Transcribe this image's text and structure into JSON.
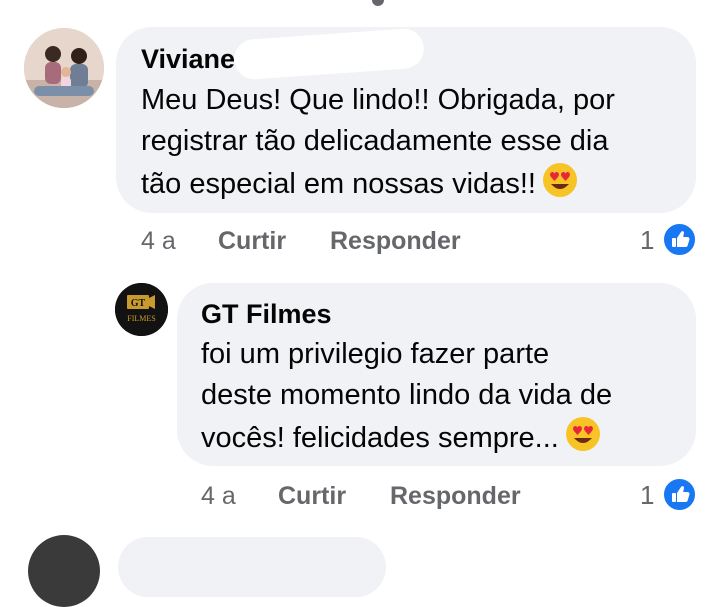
{
  "comments": [
    {
      "author": "Viviane",
      "text": "Meu Deus! Que lindo!! Obrigada, por\nregistrar tão  delicadamente esse dia\ntão  especial em nossas vidas!!",
      "emoji": "heart-eyes-emoji",
      "age": "4 a",
      "like_label": "Curtir",
      "reply_label": "Responder",
      "reaction_count": "1"
    },
    {
      "author": "GT Filmes",
      "avatar_text_top": "GT",
      "avatar_text_bottom": "FILMES",
      "text": "foi um privilegio fazer parte\ndeste momento lindo da vida de\nvocês! felicidades sempre...",
      "emoji": "heart-eyes-emoji",
      "age": "4 a",
      "like_label": "Curtir",
      "reply_label": "Responder",
      "reaction_count": "1"
    }
  ],
  "colors": {
    "bubble": "#f0f2f5",
    "secondary_text": "#65676b",
    "like_blue": "#1877f2"
  }
}
